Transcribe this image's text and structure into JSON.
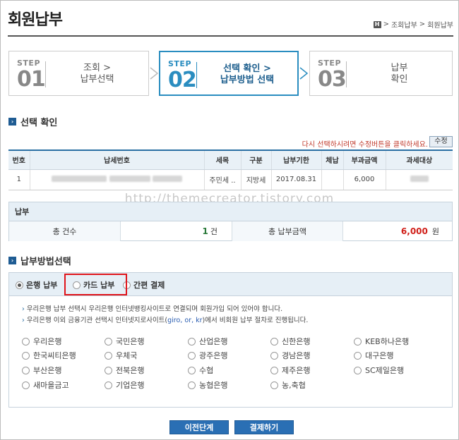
{
  "page": {
    "title": "회원납부"
  },
  "breadcrumb": {
    "home_icon": "H",
    "items": [
      "조회납부",
      "회원납부"
    ],
    "separator": ">"
  },
  "steps": [
    {
      "label": "STEP",
      "number": "01",
      "line1": "조회 >",
      "line2": "납부선택",
      "active": false
    },
    {
      "label": "STEP",
      "number": "02",
      "line1": "선택 확인 >",
      "line2": "납부방법 선택",
      "active": true
    },
    {
      "label": "STEP",
      "number": "03",
      "line1": "납부",
      "line2": "확인",
      "active": false
    }
  ],
  "selection": {
    "title": "선택 확인",
    "notice": "다시 선택하시려면 수정버튼을 클릭하세요.",
    "edit_label": "수정",
    "columns": [
      "번호",
      "납세번호",
      "세목",
      "구분",
      "납부기한",
      "체납",
      "부과금액",
      "과세대상"
    ],
    "rows": [
      {
        "no": "1",
        "tax_type": "주민세 ..",
        "category": "지방세",
        "due": "2017.08.31",
        "arrears": "",
        "amount": "6,000"
      }
    ]
  },
  "watermark": "http://themecreator.tistory.com",
  "payment": {
    "title": "납부",
    "count_label": "총 건수",
    "count_value": "1",
    "count_unit": "건",
    "total_label": "총 납부금액",
    "total_value": "6,000",
    "total_unit": "원"
  },
  "method": {
    "title": "납부방법선택",
    "tabs": [
      "은행 납부",
      "카드 납부",
      "간편 결제"
    ],
    "selected_tab": "은행 납부",
    "info1": "우리은행 납부 선택시 우리은행 인터넷뱅킹사이트로 연결되며 회원가입 되어 있어야 합니다.",
    "info2_a": "우리은행 이외 금융기관 선택시 인터넷지로사이트(",
    "info2_link": "giro, or, kr",
    "info2_b": ")에서 비회원 납부 절차로 진행됩니다.",
    "banks": [
      "우리은행",
      "국민은행",
      "산업은행",
      "신한은행",
      "KEB하나은행",
      "한국씨티은행",
      "우체국",
      "광주은행",
      "경남은행",
      "대구은행",
      "부산은행",
      "전북은행",
      "수협",
      "제주은행",
      "SC제일은행",
      "새마을금고",
      "기업은행",
      "농협은행",
      "농,축협"
    ]
  },
  "buttons": {
    "prev": "이전단계",
    "pay": "결제하기"
  },
  "colors": {
    "accent": "#2a8dc0",
    "button": "#2a6fb4",
    "highlight": "#e0141a",
    "amount": "#d0201a"
  }
}
